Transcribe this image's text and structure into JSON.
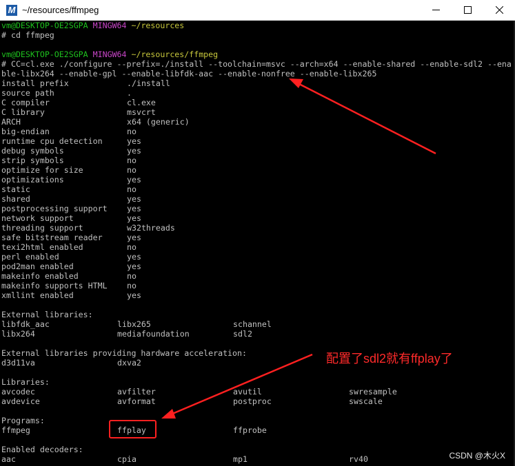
{
  "window": {
    "title": "~/resources/ffmpeg",
    "app_icon": "mintty-icon"
  },
  "prompt1": {
    "user": "vm@DESKTOP-OE2SGPA",
    "shell": "MINGW64",
    "path": "~/resources"
  },
  "cmd1": "# cd ffmpeg",
  "prompt2": {
    "user": "vm@DESKTOP-OE2SGPA",
    "shell": "MINGW64",
    "path": "~/resources/ffmpeg"
  },
  "cmd2_line1": "# CC=cl.exe ./configure --prefix=./install --toolchain=msvc --arch=x64 --enable-shared --enable-sdl2 --ena",
  "cmd2_line2": "ble-libx264 --enable-gpl --enable-libfdk-aac --enable-nonfree --enable-libx265",
  "config": [
    [
      "install prefix",
      "./install"
    ],
    [
      "source path",
      "."
    ],
    [
      "C compiler",
      "cl.exe"
    ],
    [
      "C library",
      "msvcrt"
    ],
    [
      "ARCH",
      "x64 (generic)"
    ],
    [
      "big-endian",
      "no"
    ],
    [
      "runtime cpu detection",
      "yes"
    ],
    [
      "debug symbols",
      "yes"
    ],
    [
      "strip symbols",
      "no"
    ],
    [
      "optimize for size",
      "no"
    ],
    [
      "optimizations",
      "yes"
    ],
    [
      "static",
      "no"
    ],
    [
      "shared",
      "yes"
    ],
    [
      "postprocessing support",
      "yes"
    ],
    [
      "network support",
      "yes"
    ],
    [
      "threading support",
      "w32threads"
    ],
    [
      "safe bitstream reader",
      "yes"
    ],
    [
      "texi2html enabled",
      "no"
    ],
    [
      "perl enabled",
      "yes"
    ],
    [
      "pod2man enabled",
      "yes"
    ],
    [
      "makeinfo enabled",
      "no"
    ],
    [
      "makeinfo supports HTML",
      "no"
    ],
    [
      "xmllint enabled",
      "yes"
    ]
  ],
  "external_libs": {
    "heading": "External libraries:",
    "rows": [
      [
        "libfdk_aac",
        "libx265",
        "schannel"
      ],
      [
        "libx264",
        "mediafoundation",
        "sdl2"
      ]
    ]
  },
  "hwaccel_libs": {
    "heading": "External libraries providing hardware acceleration:",
    "rows": [
      [
        "d3d11va",
        "dxva2"
      ]
    ]
  },
  "libraries": {
    "heading": "Libraries:",
    "rows": [
      [
        "avcodec",
        "avfilter",
        "avutil",
        "swresample"
      ],
      [
        "avdevice",
        "avformat",
        "postproc",
        "swscale"
      ]
    ]
  },
  "programs": {
    "heading": "Programs:",
    "rows": [
      [
        "ffmpeg",
        "ffplay",
        "ffprobe"
      ]
    ]
  },
  "decoders": {
    "heading": "Enabled decoders:",
    "rows": [
      [
        "aac",
        "cpia",
        "mp1",
        "rv40"
      ]
    ]
  },
  "annotation": "配置了sdl2就有ffplay了",
  "watermark": "CSDN @木火X",
  "colors": {
    "prompt_user": "#1ec21e",
    "prompt_shell": "#c845c8",
    "prompt_path": "#c8c83c",
    "annotation": "#ff2a2a"
  }
}
